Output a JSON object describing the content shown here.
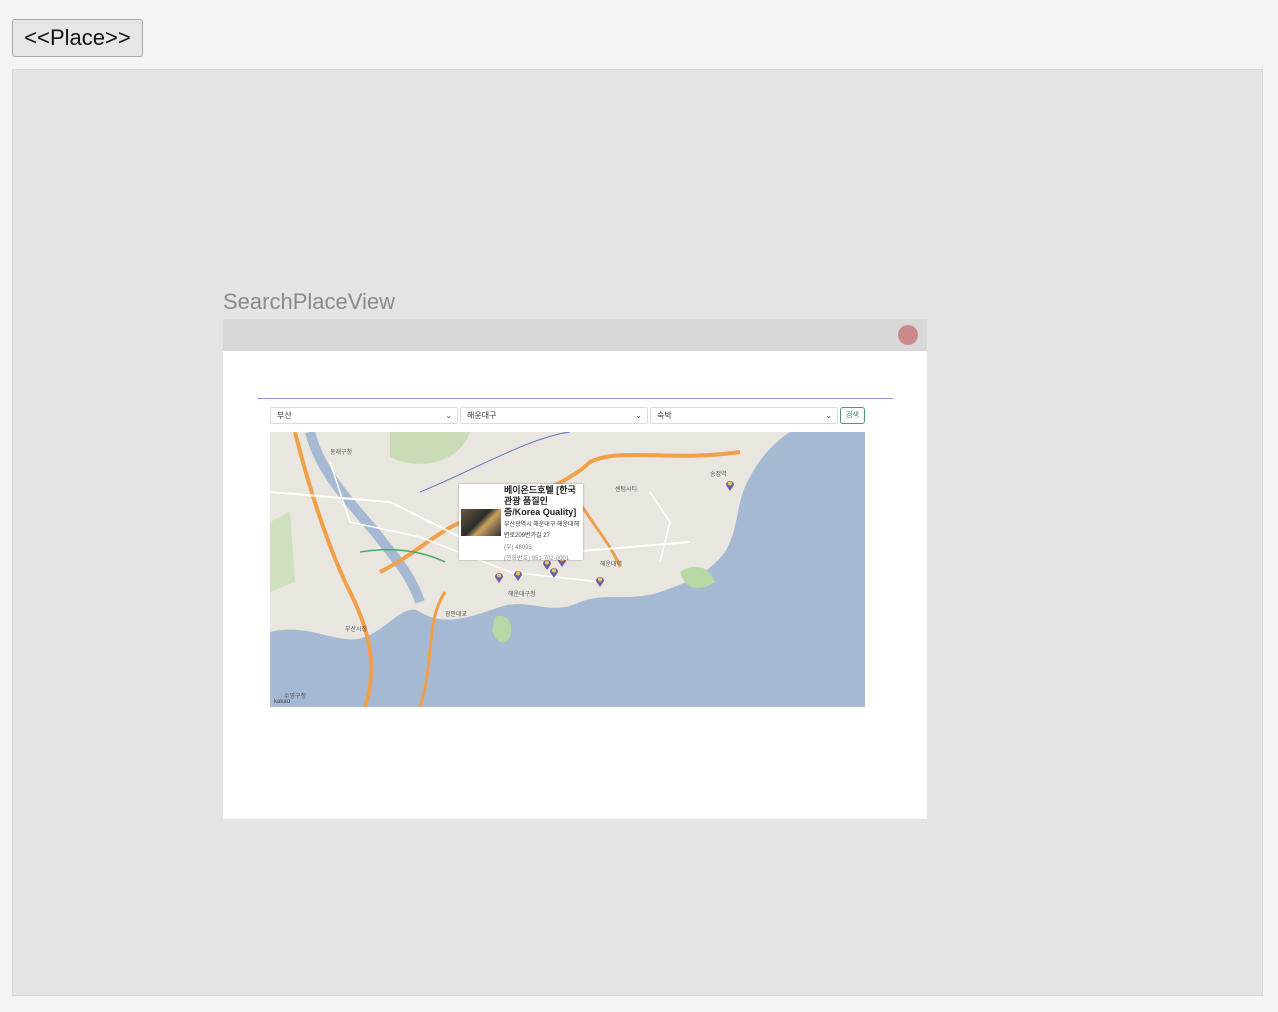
{
  "toolbar": {
    "place_button": "<<Place>>"
  },
  "view": {
    "title": "SearchPlaceView"
  },
  "filters": {
    "region": "부산",
    "district": "해운대구",
    "category": "숙박",
    "search_button": "검색"
  },
  "popup": {
    "name": "베이온드호텔 [한국관광 품질인증/Korea Quality]",
    "address": "부산광역시 해운대구 해운대해변로209번가길 27",
    "zip": "(우) 48093",
    "tel": "(전화번호) 051-702-0001"
  },
  "map": {
    "labels": [
      "부산시청",
      "해운대구청",
      "동래구청",
      "수영구청",
      "광안대교",
      "센텀시티",
      "해운대역",
      "송정역"
    ],
    "attribution": "kakao",
    "colors": {
      "sea": "#a5b9d2",
      "land": "#e9e6df",
      "highway": "#f0a048",
      "park": "#b8d7a4",
      "marker": "#6b5fa6"
    }
  }
}
